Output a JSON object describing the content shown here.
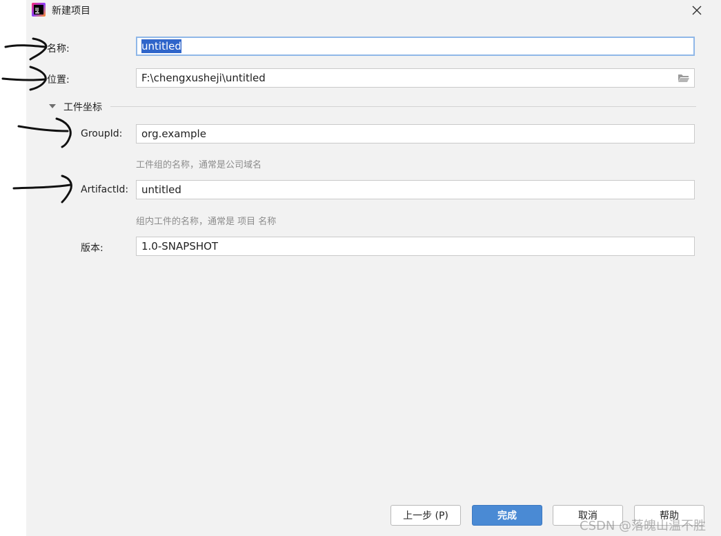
{
  "window": {
    "title": "新建项目",
    "icon": "intellij-idea-icon",
    "close_icon": "close-icon"
  },
  "form": {
    "name_label": "名称:",
    "name_value": "untitled",
    "location_label": "位置:",
    "location_value": "F:\\chengxusheji\\untitled",
    "browse_icon": "folder-open-icon",
    "section_title": "工件坐标",
    "groupid_label": "GroupId:",
    "groupid_value": "org.example",
    "groupid_hint": "工件组的名称，通常是公司域名",
    "artifactid_label": "ArtifactId:",
    "artifactid_value": "untitled",
    "artifactid_hint": "组内工件的名称，通常是 项目 名称",
    "version_label": "版本:",
    "version_value": "1.0-SNAPSHOT"
  },
  "buttons": {
    "previous": "上一步 (P)",
    "finish": "完成",
    "cancel": "取消",
    "help": "帮助"
  },
  "watermark": "CSDN @落魄山温不胜",
  "colors": {
    "dialog_bg": "#f2f2f2",
    "focus_border": "#8fb7e8",
    "selection": "#2f65ca",
    "primary_button": "#4a8ad4",
    "hint_text": "#8c8c8c"
  }
}
